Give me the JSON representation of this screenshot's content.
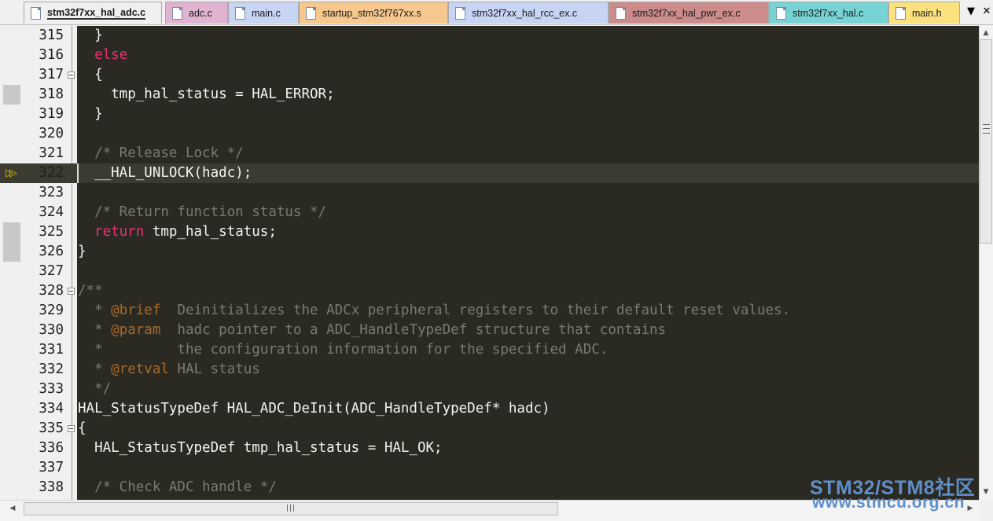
{
  "tabs": [
    {
      "label": "stm32f7xx_hal_adc.c",
      "active": true,
      "color": "#f0f0f0"
    },
    {
      "label": "adc.c",
      "active": false,
      "color": "#e0b4d0"
    },
    {
      "label": "main.c",
      "active": false,
      "color": "#c8d4f4"
    },
    {
      "label": "startup_stm32f767xx.s",
      "active": false,
      "color": "#f6c88e"
    },
    {
      "label": "stm32f7xx_hal_rcc_ex.c",
      "active": false,
      "color": "#c8d4f4"
    },
    {
      "label": "stm32f7xx_hal_pwr_ex.c",
      "active": false,
      "color": "#cc8c8c"
    },
    {
      "label": "stm32f7xx_hal.c",
      "active": false,
      "color": "#78d4d4"
    },
    {
      "label": "main.h",
      "active": false,
      "color": "#fbe27e"
    }
  ],
  "tab_list_icon": "chevron-down-icon",
  "close_icon": "close-icon",
  "editor": {
    "current_line": 322,
    "lines": [
      {
        "num": "315",
        "tokens": [
          {
            "t": "  }",
            "k": "plain"
          }
        ]
      },
      {
        "num": "316",
        "tokens": [
          {
            "t": "  else",
            "k": "keyword"
          }
        ]
      },
      {
        "num": "317",
        "fold": true,
        "tokens": [
          {
            "t": "  {",
            "k": "plain"
          }
        ]
      },
      {
        "num": "318",
        "mark": true,
        "tokens": [
          {
            "t": "    tmp_hal_status = HAL_ERROR;",
            "k": "plain"
          }
        ]
      },
      {
        "num": "319",
        "tokens": [
          {
            "t": "  }",
            "k": "plain"
          }
        ]
      },
      {
        "num": "320",
        "tokens": []
      },
      {
        "num": "321",
        "tokens": [
          {
            "t": "  /* Release Lock */",
            "k": "comment"
          }
        ]
      },
      {
        "num": "322",
        "current": true,
        "tokens": [
          {
            "t": "  __HAL_UNLOCK(hadc);",
            "k": "plain"
          }
        ]
      },
      {
        "num": "323",
        "tokens": []
      },
      {
        "num": "324",
        "tokens": [
          {
            "t": "  /* Return function status */",
            "k": "comment"
          }
        ]
      },
      {
        "num": "325",
        "mark": true,
        "tokens": [
          {
            "t": "  return",
            "k": "keyword"
          },
          {
            "t": " tmp_hal_status;",
            "k": "plain"
          }
        ]
      },
      {
        "num": "326",
        "mark": true,
        "tokens": [
          {
            "t": "}",
            "k": "plain"
          }
        ]
      },
      {
        "num": "327",
        "tokens": []
      },
      {
        "num": "328",
        "fold": true,
        "tokens": [
          {
            "t": "/**",
            "k": "comment"
          }
        ]
      },
      {
        "num": "329",
        "tokens": [
          {
            "t": "  * ",
            "k": "comment"
          },
          {
            "t": "@brief",
            "k": "tag"
          },
          {
            "t": "  Deinitializes the ADCx peripheral registers to their default reset values.",
            "k": "comment"
          }
        ]
      },
      {
        "num": "330",
        "tokens": [
          {
            "t": "  * ",
            "k": "comment"
          },
          {
            "t": "@param",
            "k": "tag"
          },
          {
            "t": "  hadc pointer to a ADC_HandleTypeDef structure that contains",
            "k": "comment"
          }
        ]
      },
      {
        "num": "331",
        "tokens": [
          {
            "t": "  *         the configuration information for the specified ADC.",
            "k": "comment"
          }
        ]
      },
      {
        "num": "332",
        "tokens": [
          {
            "t": "  * ",
            "k": "comment"
          },
          {
            "t": "@retval",
            "k": "tag"
          },
          {
            "t": " HAL status",
            "k": "comment"
          }
        ]
      },
      {
        "num": "333",
        "tokens": [
          {
            "t": "  */",
            "k": "comment"
          }
        ]
      },
      {
        "num": "334",
        "tokens": [
          {
            "t": "HAL_StatusTypeDef HAL_ADC_DeInit(ADC_HandleTypeDef* hadc)",
            "k": "plain"
          }
        ]
      },
      {
        "num": "335",
        "fold": true,
        "tokens": [
          {
            "t": "{",
            "k": "plain"
          }
        ]
      },
      {
        "num": "336",
        "tokens": [
          {
            "t": "  HAL_StatusTypeDef tmp_hal_status = HAL_OK;",
            "k": "plain"
          }
        ]
      },
      {
        "num": "337",
        "tokens": []
      },
      {
        "num": "338",
        "tokens": [
          {
            "t": "  /* Check ADC handle */",
            "k": "comment"
          }
        ]
      }
    ]
  },
  "watermark": {
    "line1": "STM32/STM8社区",
    "line2": "www.stmcu.org.cn"
  }
}
